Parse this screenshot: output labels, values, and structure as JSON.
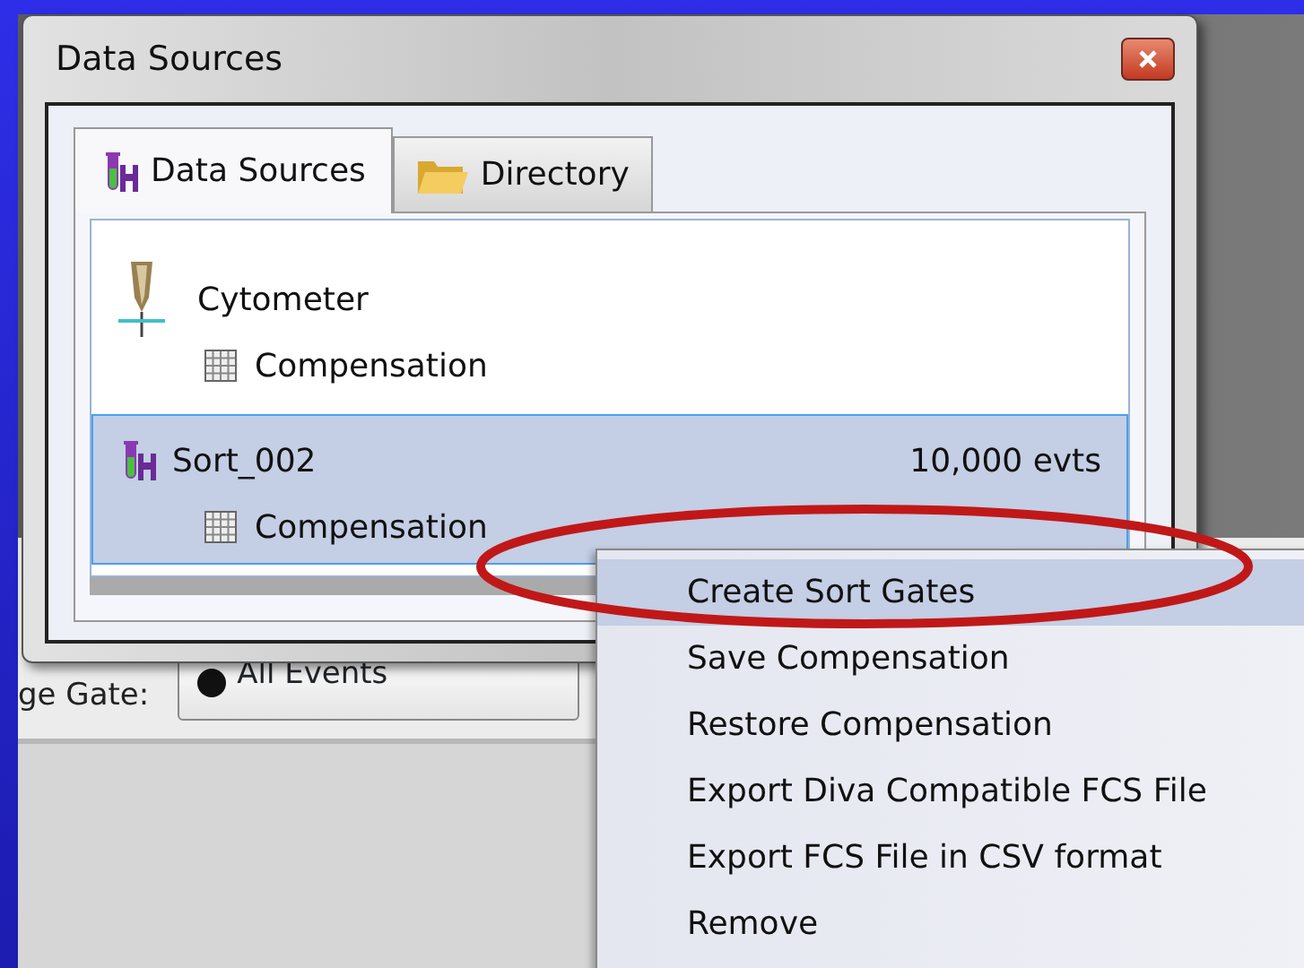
{
  "background_app": {
    "field_label": "ge Gate:",
    "field_value": "All Events"
  },
  "window": {
    "title": "Data Sources"
  },
  "tabs": [
    {
      "label": "Data Sources",
      "kind": "tube",
      "selected": true
    },
    {
      "label": "Directory",
      "kind": "folder",
      "selected": false
    }
  ],
  "sources": [
    {
      "name": "Cytometer",
      "kind": "cytometer",
      "selected": false,
      "children": [
        {
          "name": "Compensation"
        }
      ]
    },
    {
      "name": "Sort_002",
      "kind": "tube",
      "count": "10,000 evts",
      "selected": true,
      "children": [
        {
          "name": "Compensation"
        }
      ]
    }
  ],
  "context_menu": [
    {
      "label": "Create Sort Gates",
      "selected": true
    },
    {
      "label": "Save Compensation",
      "selected": false
    },
    {
      "label": "Restore Compensation",
      "selected": false
    },
    {
      "label": "Export Diva Compatible FCS File",
      "selected": false
    },
    {
      "label": "Export FCS File in CSV format",
      "selected": false
    },
    {
      "label": "Remove",
      "selected": false
    }
  ]
}
